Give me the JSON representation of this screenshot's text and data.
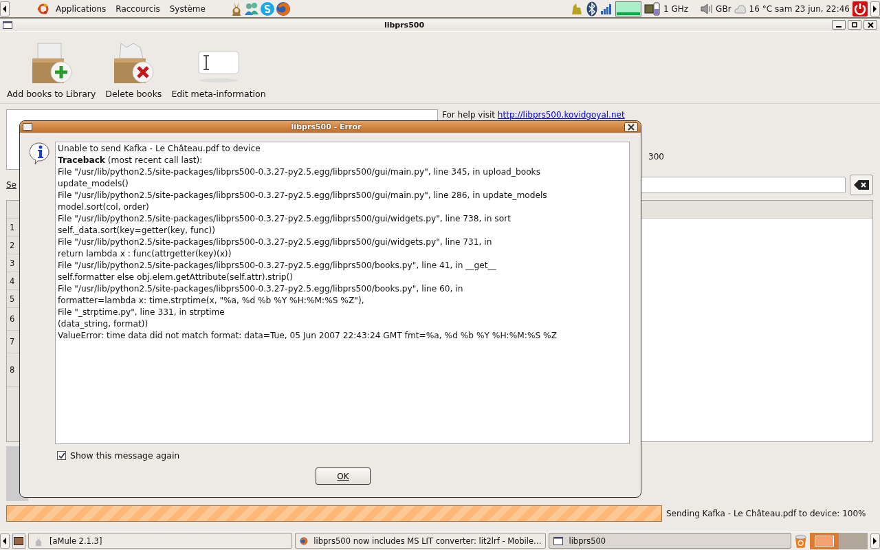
{
  "top_panel": {
    "menus": [
      "Applications",
      "Raccourcis",
      "Système"
    ],
    "cpu_freq": "1 GHz",
    "keyboard_layout": "GBr",
    "temperature": "16 °C",
    "clock": "sam 23 jun, 22:46"
  },
  "window": {
    "title": "libprs500"
  },
  "toolbar": [
    {
      "kind": "add",
      "label": "Add books to Library"
    },
    {
      "kind": "delete",
      "label": "Delete books"
    },
    {
      "kind": "edit",
      "label": "Edit meta-information"
    }
  ],
  "help": {
    "text": "For help visit",
    "link": "http://libprs500.kovidgoyal.net"
  },
  "device_info_fragment": "300",
  "search": {
    "label_fragment": "Se"
  },
  "book_table": {
    "row_numbers": [
      "1",
      "2",
      "3",
      "4",
      "5",
      "6",
      "7",
      "8"
    ]
  },
  "progress": {
    "level": 1,
    "text": "Sending Kafka - Le Château.pdf to device: 100%"
  },
  "dialog": {
    "title": "libprs500 - Error",
    "lines": [
      "Unable to send Kafka - Le Château.pdf to device",
      "**Traceback** (most recent call last):",
      "File \"/usr/lib/python2.5/site-packages/libprs500-0.3.27-py2.5.egg/libprs500/gui/main.py\", line 345, in upload_books",
      "update_models()",
      "File \"/usr/lib/python2.5/site-packages/libprs500-0.3.27-py2.5.egg/libprs500/gui/main.py\", line 286, in update_models",
      "model.sort(col, order)",
      "File \"/usr/lib/python2.5/site-packages/libprs500-0.3.27-py2.5.egg/libprs500/gui/widgets.py\", line 738, in sort",
      "self._data.sort(key=getter(key, func))",
      "File \"/usr/lib/python2.5/site-packages/libprs500-0.3.27-py2.5.egg/libprs500/gui/widgets.py\", line 731, in",
      "return lambda x : func(attrgetter(key)(x))",
      "File \"/usr/lib/python2.5/site-packages/libprs500-0.3.27-py2.5.egg/libprs500/books.py\", line 41, in __get__",
      "self.formatter else obj.elem.getAttribute(self.attr).strip()",
      "File \"/usr/lib/python2.5/site-packages/libprs500-0.3.27-py2.5.egg/libprs500/books.py\", line 60, in",
      "formatter=lambda x: time.strptime(x, \"%a, %d %b %Y %H:%M:%S %Z\"),",
      "File \"_strptime.py\", line 331, in strptime",
      "(data_string, format))",
      "ValueError: time data did not match format: data=Tue, 05 Jun 2007 22:43:24 GMT fmt=%a, %d %b %Y %H:%M:%S %Z"
    ],
    "show_again": {
      "label": "Show this message again",
      "checked": true
    },
    "ok_button": "OK"
  },
  "taskbar": [
    {
      "kind": "amule",
      "label": "[aMule 2.1.3]",
      "selected": false
    },
    {
      "kind": "browser",
      "label": "libprs500 now includes MS LIT converter: lit2lrf - Mobile…",
      "selected": false
    },
    {
      "kind": "window",
      "label": "libprs500",
      "selected": true
    }
  ]
}
